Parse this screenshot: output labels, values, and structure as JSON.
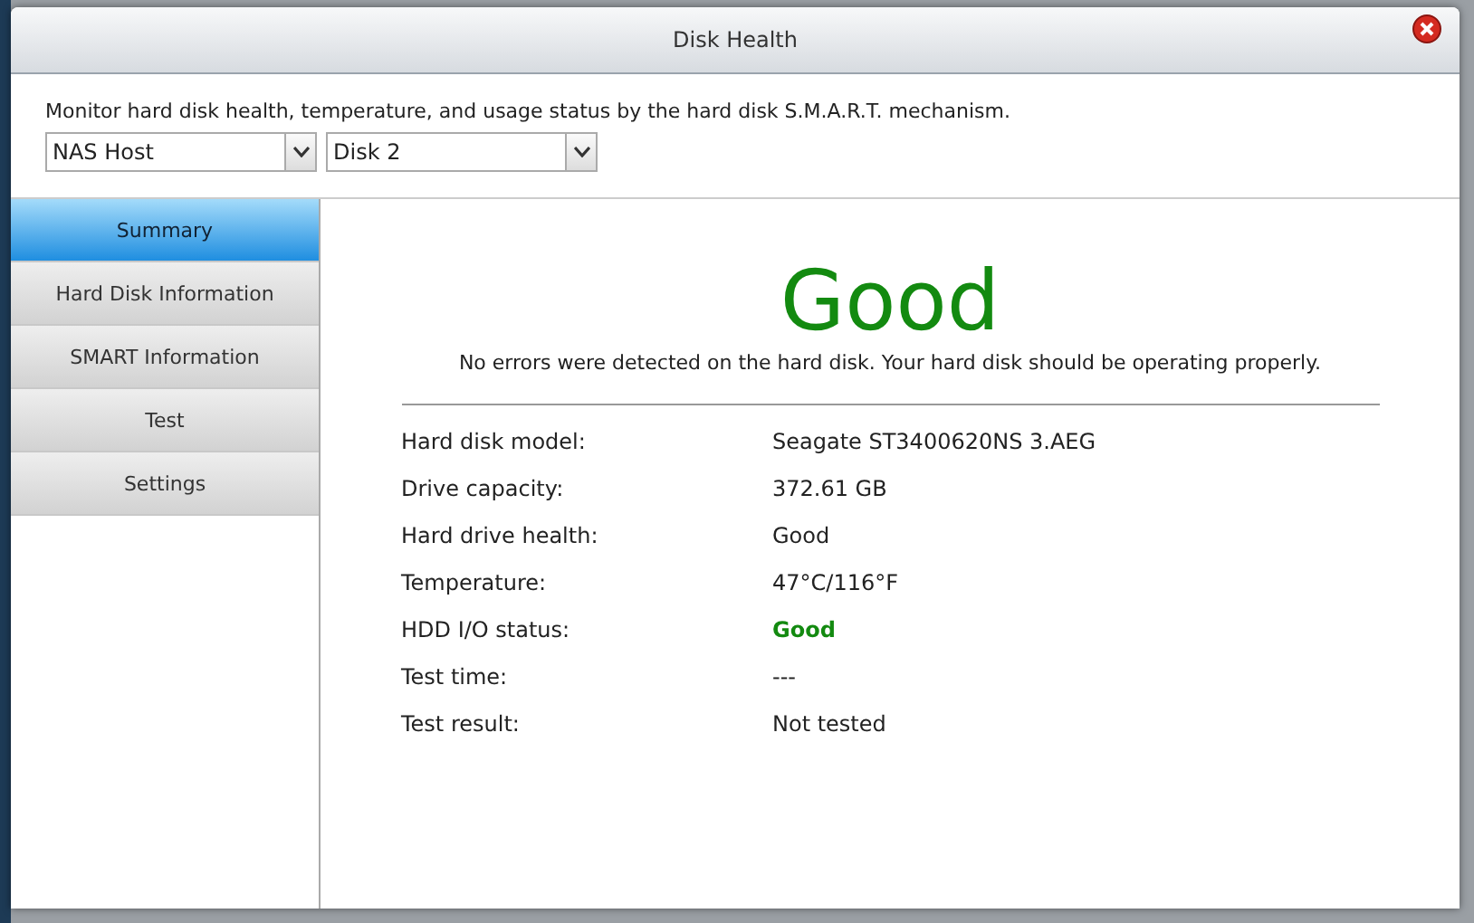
{
  "window": {
    "title": "Disk Health"
  },
  "description": "Monitor hard disk health, temperature, and usage status by the hard disk S.M.A.R.T. mechanism.",
  "selects": [
    {
      "value": "NAS Host"
    },
    {
      "value": "Disk 2"
    }
  ],
  "sidebar": {
    "items": [
      {
        "label": "Summary",
        "selected": true
      },
      {
        "label": "Hard Disk Information",
        "selected": false
      },
      {
        "label": "SMART Information",
        "selected": false
      },
      {
        "label": "Test",
        "selected": false
      },
      {
        "label": "Settings",
        "selected": false
      }
    ]
  },
  "summary": {
    "status": "Good",
    "message": "No errors were detected on the hard disk. Your hard disk should be operating properly.",
    "rows": [
      {
        "label": "Hard disk model:",
        "value": "Seagate ST3400620NS 3.AEG",
        "kind": "plain"
      },
      {
        "label": "Drive capacity:",
        "value": "372.61 GB",
        "kind": "plain"
      },
      {
        "label": "Hard drive health:",
        "value": "Good",
        "kind": "plain"
      },
      {
        "label": "Temperature:",
        "value": "47°C/116°F",
        "kind": "plain"
      },
      {
        "label": "HDD I/O status:",
        "value": "Good",
        "kind": "good"
      },
      {
        "label": "Test time:",
        "value": "---",
        "kind": "plain"
      },
      {
        "label": "Test result:",
        "value": "Not tested",
        "kind": "plain"
      }
    ]
  }
}
